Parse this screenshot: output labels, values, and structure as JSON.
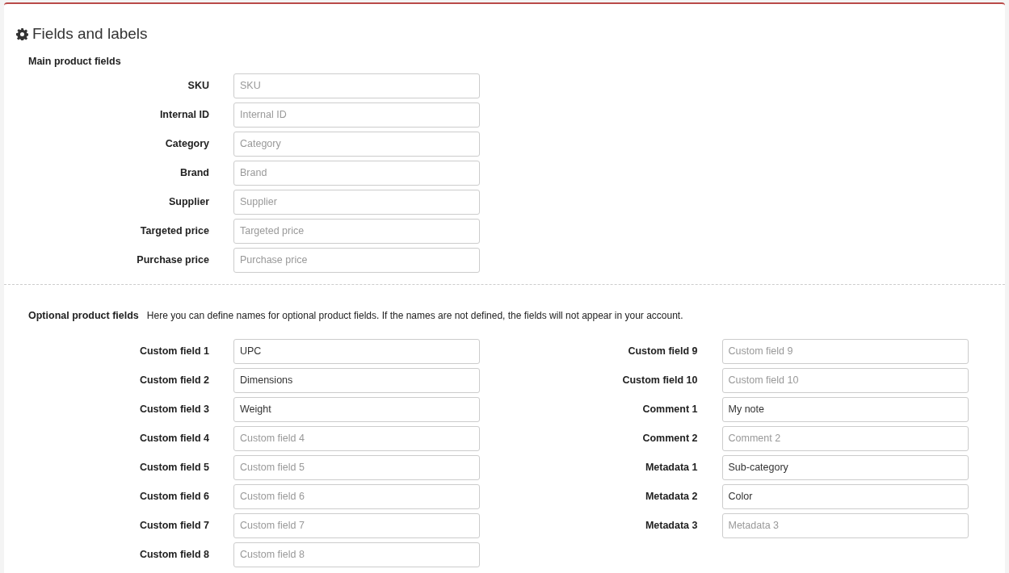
{
  "title": "Fields and labels",
  "main_section": {
    "heading": "Main product fields",
    "fields": [
      {
        "label": "SKU",
        "placeholder": "SKU"
      },
      {
        "label": "Internal ID",
        "placeholder": "Internal ID"
      },
      {
        "label": "Category",
        "placeholder": "Category"
      },
      {
        "label": "Brand",
        "placeholder": "Brand"
      },
      {
        "label": "Supplier",
        "placeholder": "Supplier"
      },
      {
        "label": "Targeted price",
        "placeholder": "Targeted price"
      },
      {
        "label": "Purchase price",
        "placeholder": "Purchase price"
      }
    ]
  },
  "optional_section": {
    "heading": "Optional product fields",
    "description": "Here you can define names for optional product fields. If the names are not defined, the fields will not appear in your account.",
    "left_fields": [
      {
        "label": "Custom field 1",
        "value": "UPC"
      },
      {
        "label": "Custom field 2",
        "value": "Dimensions"
      },
      {
        "label": "Custom field 3",
        "value": "Weight"
      },
      {
        "label": "Custom field 4",
        "placeholder": "Custom field 4"
      },
      {
        "label": "Custom field 5",
        "placeholder": "Custom field 5"
      },
      {
        "label": "Custom field 6",
        "placeholder": "Custom field 6"
      },
      {
        "label": "Custom field 7",
        "placeholder": "Custom field 7"
      },
      {
        "label": "Custom field 8",
        "placeholder": "Custom field 8"
      }
    ],
    "right_fields": [
      {
        "label": "Custom field 9",
        "placeholder": "Custom field 9"
      },
      {
        "label": "Custom field 10",
        "placeholder": "Custom field 10"
      },
      {
        "label": "Comment 1",
        "value": "My note"
      },
      {
        "label": "Comment 2",
        "placeholder": "Comment 2"
      },
      {
        "label": "Metadata 1",
        "value": "Sub-category"
      },
      {
        "label": "Metadata 2",
        "value": "Color"
      },
      {
        "label": "Metadata 3",
        "placeholder": "Metadata 3"
      }
    ]
  }
}
